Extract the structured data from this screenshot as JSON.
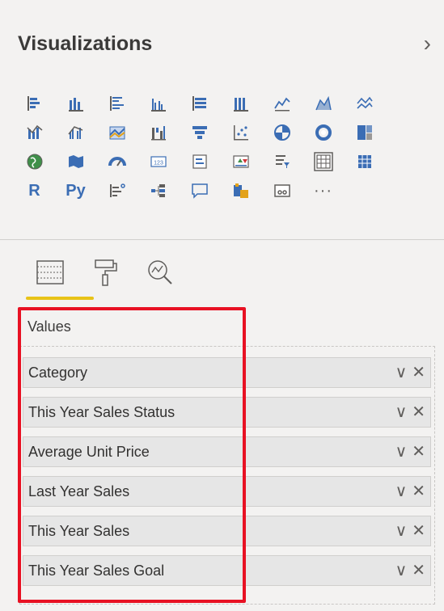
{
  "header": {
    "title": "Visualizations",
    "expand_icon": "chevron-right-icon"
  },
  "gallery": {
    "rows": [
      [
        "stacked-bar-chart-icon",
        "stacked-column-chart-icon",
        "clustered-bar-chart-icon",
        "clustered-column-chart-icon",
        "100-stacked-bar-icon",
        "100-stacked-column-icon",
        "line-chart-icon",
        "area-chart-icon",
        "stacked-area-chart-icon"
      ],
      [
        "line-and-stacked-column-icon",
        "line-and-clustered-column-icon",
        "ribbon-chart-icon",
        "waterfall-chart-icon",
        "funnel-chart-icon",
        "scatter-chart-icon",
        "pie-chart-icon",
        "donut-chart-icon",
        "treemap-icon"
      ],
      [
        "map-icon",
        "filled-map-icon",
        "gauge-icon",
        "card-icon",
        "multi-row-card-icon",
        "kpi-icon",
        "slicer-icon",
        "table-icon",
        "matrix-icon"
      ],
      [
        "r-visual-icon",
        "python-visual-icon",
        "key-influencers-icon",
        "decomposition-tree-icon",
        "qa-icon",
        "smart-narrative-icon",
        "paginated-report-icon",
        "more-visuals-icon"
      ]
    ],
    "r_label": "R",
    "py_label": "Py",
    "more_label": "···"
  },
  "tabs": [
    {
      "icon": "fields-icon",
      "active": true
    },
    {
      "icon": "format-paint-roller-icon",
      "active": false
    },
    {
      "icon": "analytics-magnifier-icon",
      "active": false
    }
  ],
  "values_well": {
    "label": "Values",
    "fields": [
      "Category",
      "This Year Sales Status",
      "Average Unit Price",
      "Last Year Sales",
      "This Year Sales",
      "This Year Sales Goal"
    ],
    "dropdown_glyph": "∨",
    "remove_glyph": "✕"
  },
  "colors": {
    "accent_underline": "#e8c317",
    "highlight_box": "#e81123",
    "chart_blue": "#3b6db4"
  }
}
